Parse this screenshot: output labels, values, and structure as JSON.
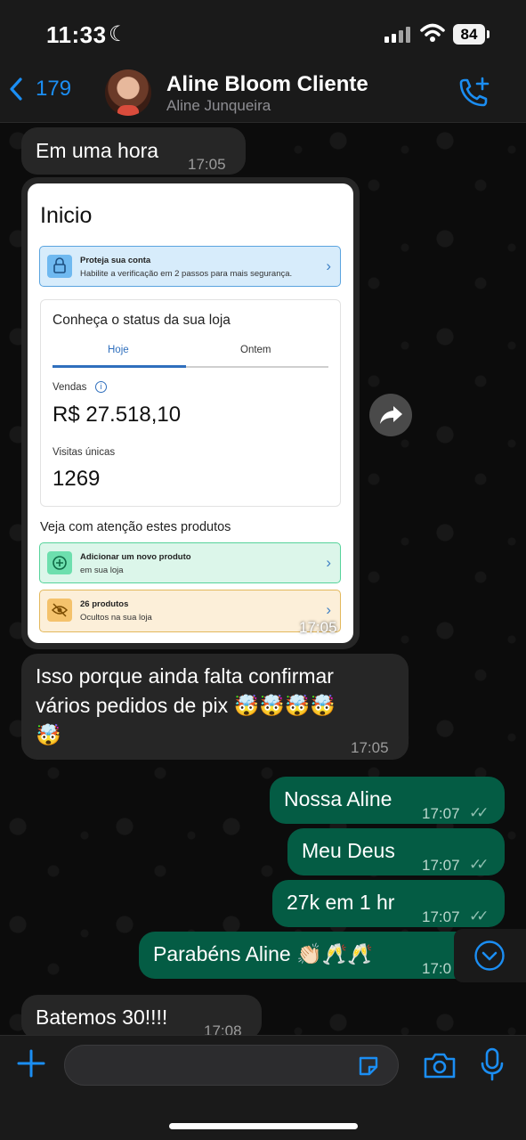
{
  "status_bar": {
    "time": "11:33",
    "battery": "84"
  },
  "header": {
    "back_count": "179",
    "contact_name": "Aline Bloom Cliente",
    "contact_sub": "Aline Junqueira"
  },
  "messages": [
    {
      "dir": "in",
      "text": "Em uma hora",
      "time": "17:05"
    },
    {
      "dir": "in",
      "type": "image",
      "time": "17:05"
    },
    {
      "dir": "in",
      "text_line1": "Isso porque ainda falta confirmar",
      "text_line2": "vários pedidos de pix 🤯🤯🤯🤯",
      "text_line3": "🤯",
      "time": "17:05"
    },
    {
      "dir": "out",
      "text": "Nossa Aline",
      "time": "17:07"
    },
    {
      "dir": "out",
      "text": "Meu Deus",
      "time": "17:07"
    },
    {
      "dir": "out",
      "text": "27k em 1 hr",
      "time": "17:07"
    },
    {
      "dir": "out",
      "text": "Parabéns Aline 👏🏻🥂🥂",
      "time": "17:0"
    },
    {
      "dir": "in",
      "text": "Batemos 30!!!!",
      "time": "17:08"
    }
  ],
  "image_screenshot": {
    "title": "Inicio",
    "alert_title": "Proteja sua conta",
    "alert_sub": "Habilite a verificação em 2 passos para mais segurança.",
    "card_title": "Conheça o status da sua loja",
    "tab_today": "Hoje",
    "tab_yesterday": "Ontem",
    "sales_label": "Vendas",
    "sales_value": "R$ 27.518,10",
    "visits_label": "Visitas únicas",
    "visits_value": "1269",
    "section_title": "Veja com atenção estes produtos",
    "row1_title": "Adicionar um novo produto",
    "row1_sub": "em sua loja",
    "row2_title": "26 produtos",
    "row2_sub": "Ocultos na sua loja"
  },
  "composer": {
    "placeholder": ""
  },
  "colors": {
    "accent": "#1b8ef3",
    "outgoing_bubble": "#045c44",
    "incoming_bubble": "#262626"
  }
}
